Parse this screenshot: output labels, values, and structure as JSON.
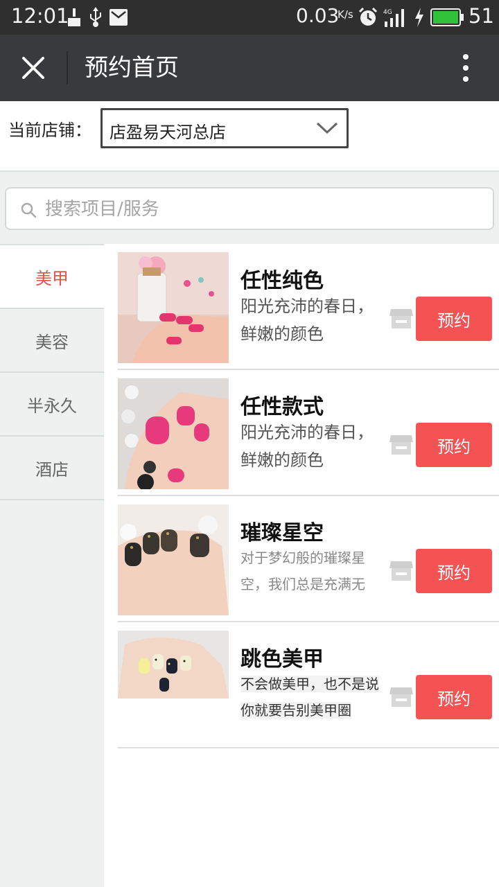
{
  "status_bar": {
    "time": "12:01",
    "net_speed": "0.03",
    "net_speed_unit": "K/s",
    "battery_level": "51",
    "icons_left": [
      "broom-icon",
      "usb-icon",
      "mail-icon"
    ],
    "icons_right": [
      "alarm-icon",
      "signal-4g-icon",
      "charging-icon",
      "battery-icon"
    ]
  },
  "title_bar": {
    "title": "预约首页"
  },
  "store": {
    "label": "当前店铺：",
    "selected": "店盈易天河总店"
  },
  "search": {
    "placeholder": "搜索项目/服务"
  },
  "sidebar": {
    "items": [
      {
        "label": "美甲",
        "active": true
      },
      {
        "label": "美容",
        "active": false
      },
      {
        "label": "半永久",
        "active": false
      },
      {
        "label": "酒店",
        "active": false
      }
    ]
  },
  "services": [
    {
      "name": "任性纯色",
      "desc": "阳光充沛的春日，鲜嫩的颜色",
      "button": "预约"
    },
    {
      "name": "任性款式",
      "desc": "阳光充沛的春日，鲜嫩的颜色",
      "button": "预约"
    },
    {
      "name": "璀璨星空",
      "desc": "对于梦幻般的璀璨星空，我们总是充满无",
      "button": "预约"
    },
    {
      "name": "跳色美甲",
      "desc": "不会做美甲，也不是说你就要告别美甲圈",
      "button": "预约"
    }
  ],
  "colors": {
    "accent": "#f55353",
    "active_tab": "#e8514b",
    "title_bar": "#393a3e",
    "status_bar": "#2f2f2f"
  }
}
